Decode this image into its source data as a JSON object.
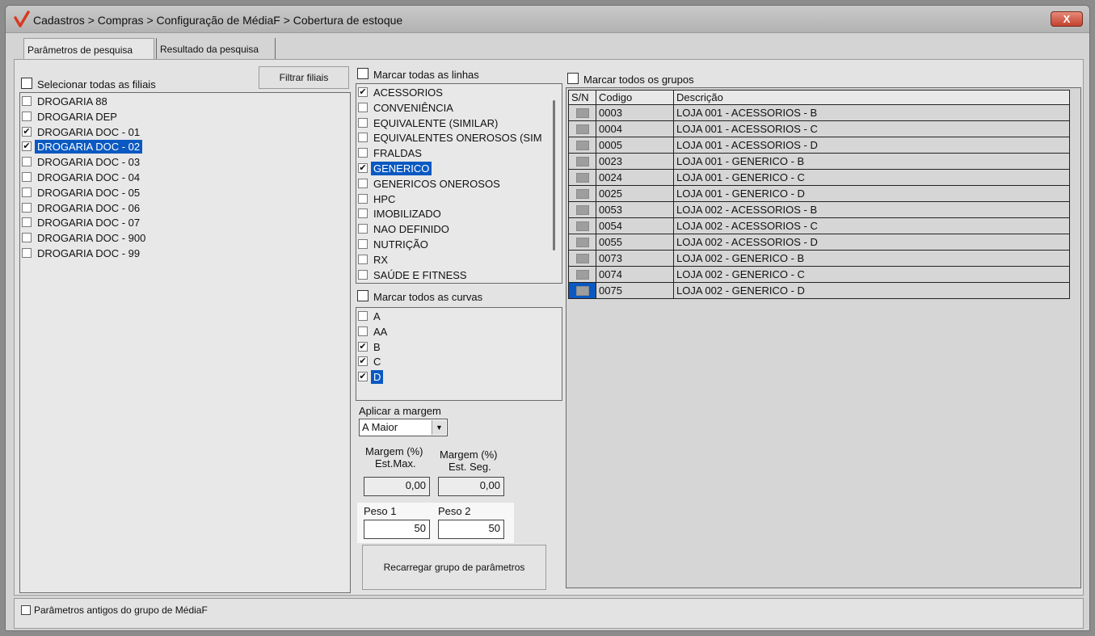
{
  "window": {
    "title": "Cadastros > Compras > Configuração de MédiaF > Cobertura de estoque",
    "close_label": "X"
  },
  "tabs": [
    {
      "label": "Parâmetros de pesquisa",
      "active": true
    },
    {
      "label": "Resultado da pesquisa",
      "active": false
    }
  ],
  "filiais": {
    "select_all_label": "Selecionar todas as filiais",
    "filter_button": "Filtrar filiais",
    "items": [
      {
        "label": "DROGARIA 88",
        "checked": false,
        "selected": false
      },
      {
        "label": "DROGARIA DEP",
        "checked": false,
        "selected": false
      },
      {
        "label": "DROGARIA DOC - 01",
        "checked": true,
        "selected": false
      },
      {
        "label": "DROGARIA DOC - 02",
        "checked": true,
        "selected": true
      },
      {
        "label": "DROGARIA DOC - 03",
        "checked": false,
        "selected": false
      },
      {
        "label": "DROGARIA DOC - 04",
        "checked": false,
        "selected": false
      },
      {
        "label": "DROGARIA DOC - 05",
        "checked": false,
        "selected": false
      },
      {
        "label": "DROGARIA DOC - 06",
        "checked": false,
        "selected": false
      },
      {
        "label": "DROGARIA DOC - 07",
        "checked": false,
        "selected": false
      },
      {
        "label": "DROGARIA DOC - 900",
        "checked": false,
        "selected": false
      },
      {
        "label": "DROGARIA DOC - 99",
        "checked": false,
        "selected": false
      }
    ]
  },
  "linhas": {
    "select_all_label": "Marcar todas as linhas",
    "items": [
      {
        "label": "ACESSORIOS",
        "checked": true,
        "selected": false
      },
      {
        "label": "CONVENIÊNCIA",
        "checked": false,
        "selected": false
      },
      {
        "label": "EQUIVALENTE (SIMILAR)",
        "checked": false,
        "selected": false
      },
      {
        "label": "EQUIVALENTES ONEROSOS (SIM",
        "checked": false,
        "selected": false
      },
      {
        "label": "FRALDAS",
        "checked": false,
        "selected": false
      },
      {
        "label": "GENERICO",
        "checked": true,
        "selected": true
      },
      {
        "label": "GENERICOS ONEROSOS",
        "checked": false,
        "selected": false
      },
      {
        "label": "HPC",
        "checked": false,
        "selected": false
      },
      {
        "label": "IMOBILIZADO",
        "checked": false,
        "selected": false
      },
      {
        "label": "NAO DEFINIDO",
        "checked": false,
        "selected": false
      },
      {
        "label": "NUTRIÇÃO",
        "checked": false,
        "selected": false
      },
      {
        "label": "RX",
        "checked": false,
        "selected": false
      },
      {
        "label": "SAÚDE E FITNESS",
        "checked": false,
        "selected": false
      }
    ]
  },
  "curvas": {
    "select_all_label": "Marcar todos as curvas",
    "items": [
      {
        "label": "A",
        "checked": false,
        "selected": false
      },
      {
        "label": "AA",
        "checked": false,
        "selected": false
      },
      {
        "label": "B",
        "checked": true,
        "selected": false
      },
      {
        "label": "C",
        "checked": true,
        "selected": false
      },
      {
        "label": "D",
        "checked": true,
        "selected": true
      }
    ]
  },
  "margem": {
    "apply_label": "Aplicar a margem",
    "apply_value": "A Maior",
    "max_label_1": "Margem (%)",
    "max_label_2": "Est.Max.",
    "max_value": "0,00",
    "seg_label_1": "Margem (%)",
    "seg_label_2": "Est. Seg.",
    "seg_value": "0,00"
  },
  "pesos": {
    "peso1_label": "Peso 1",
    "peso1_value": "50",
    "peso2_label": "Peso 2",
    "peso2_value": "50"
  },
  "reload_button": "Recarregar grupo de parâmetros",
  "grupos": {
    "select_all_label": "Marcar todos os grupos",
    "columns": [
      "S/N",
      "Codigo",
      "Descrição"
    ],
    "rows": [
      {
        "codigo": "0003",
        "descricao": "LOJA 001 - ACESSORIOS - B",
        "selected": false
      },
      {
        "codigo": "0004",
        "descricao": "LOJA 001 - ACESSORIOS - C",
        "selected": false
      },
      {
        "codigo": "0005",
        "descricao": "LOJA 001 - ACESSORIOS - D",
        "selected": false
      },
      {
        "codigo": "0023",
        "descricao": "LOJA 001 - GENERICO - B",
        "selected": false
      },
      {
        "codigo": "0024",
        "descricao": "LOJA 001 - GENERICO - C",
        "selected": false
      },
      {
        "codigo": "0025",
        "descricao": "LOJA 001 - GENERICO - D",
        "selected": false
      },
      {
        "codigo": "0053",
        "descricao": "LOJA 002 - ACESSORIOS - B",
        "selected": false
      },
      {
        "codigo": "0054",
        "descricao": "LOJA 002 - ACESSORIOS - C",
        "selected": false
      },
      {
        "codigo": "0055",
        "descricao": "LOJA 002 - ACESSORIOS - D",
        "selected": false
      },
      {
        "codigo": "0073",
        "descricao": "LOJA 002 - GENERICO - B",
        "selected": false
      },
      {
        "codigo": "0074",
        "descricao": "LOJA 002 - GENERICO - C",
        "selected": false
      },
      {
        "codigo": "0075",
        "descricao": "LOJA 002 - GENERICO - D",
        "selected": true
      }
    ]
  },
  "footer": {
    "old_params_label": "Parâmetros antigos do grupo de MédiaF"
  },
  "colors": {
    "selection": "#0a59c2",
    "window_bg": "#d4d4d4"
  }
}
